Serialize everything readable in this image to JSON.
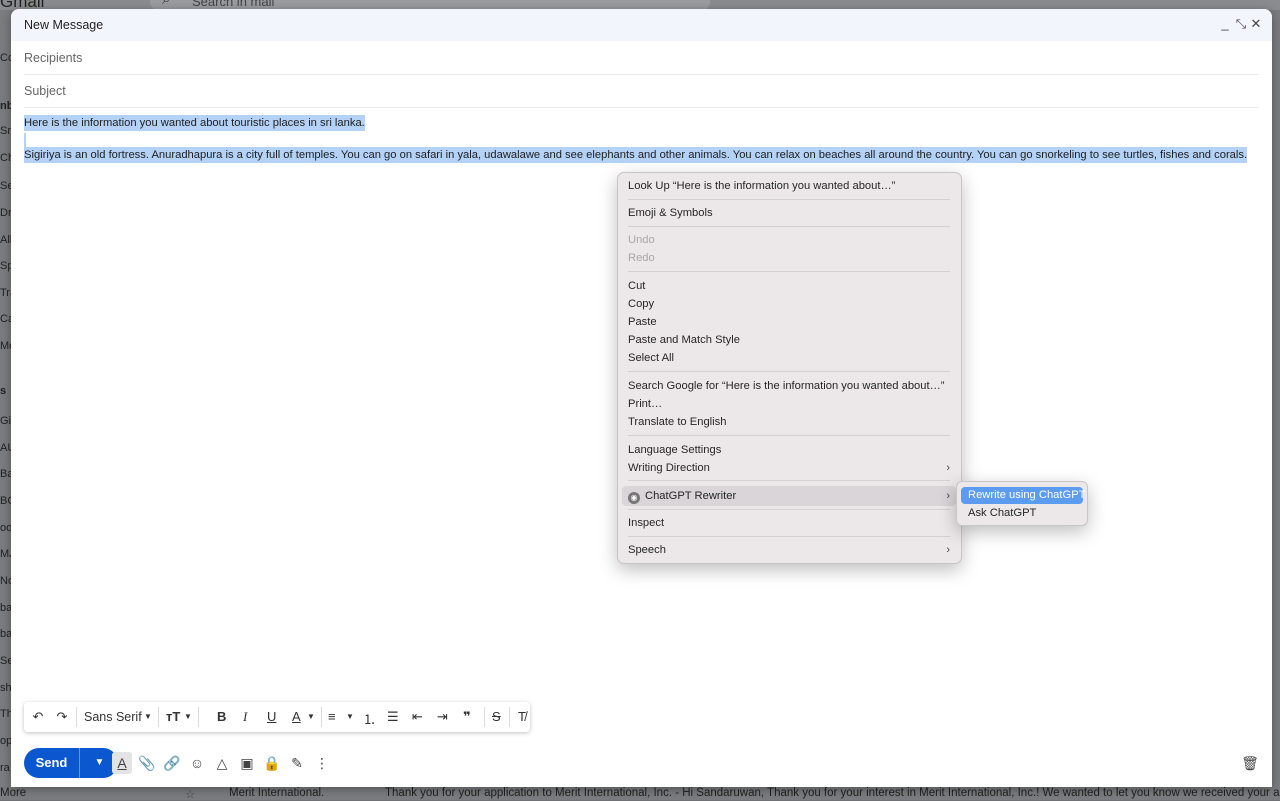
{
  "background": {
    "app_name": "Gmail",
    "search_placeholder": "Search in mail",
    "sidebar_fragments": [
      "Co",
      "nb",
      "Sn",
      "Ch",
      "Se",
      "Dr",
      "All",
      "Sp",
      "Tra",
      "Ca",
      "Mo",
      "s",
      "Gi",
      "AU",
      "Ba",
      "BC",
      "oo",
      "MJ",
      "No",
      "ba",
      "ba",
      "Se",
      "sh",
      "Th",
      "op",
      "ra",
      "More"
    ],
    "bottom_row": {
      "sender": "Merit International.",
      "snippet": "Thank you for your application to Merit International, Inc. - Hi Sandaruwan, Thank you for your interest in Merit International, Inc.! We wanted to let you know we received your appli..."
    }
  },
  "compose": {
    "title": "New Message",
    "recipients_placeholder": "Recipients",
    "subject_placeholder": "Subject",
    "body": {
      "line1": "Here is the information you wanted about touristic places in sri lanka.",
      "line2": "Sigiriya is an old fortress. Anuradhapura is a city full of temples. You can go on safari in yala, udawalawe and see elephants and other animals. You can relax on beaches all around the country. You can go snorkeling to see turtles, fishes and corals."
    },
    "toolbar": {
      "font": "Sans Serif"
    },
    "send_label": "Send"
  },
  "context_menu": {
    "items": [
      {
        "label": "Look Up “Here is the information you wanted about…”"
      },
      {
        "label": "Emoji & Symbols"
      },
      {
        "label": "Undo",
        "disabled": true
      },
      {
        "label": "Redo",
        "disabled": true
      },
      {
        "label": "Cut"
      },
      {
        "label": "Copy"
      },
      {
        "label": "Paste"
      },
      {
        "label": "Paste and Match Style"
      },
      {
        "label": "Select All"
      },
      {
        "label": "Search Google for “Here is the information you wanted about…”"
      },
      {
        "label": "Print…"
      },
      {
        "label": "Translate to English"
      },
      {
        "label": "Language Settings"
      },
      {
        "label": "Writing Direction"
      },
      {
        "label": "ChatGPT Rewriter"
      },
      {
        "label": "Inspect"
      },
      {
        "label": "Speech"
      }
    ],
    "submenu": [
      {
        "label": "Rewrite using ChatGPT"
      },
      {
        "label": "Ask ChatGPT"
      }
    ]
  },
  "colors": {
    "send_button": "#0b57d0",
    "selection": "#b4d2f5",
    "submenu_highlight": "#5b9bf0"
  }
}
